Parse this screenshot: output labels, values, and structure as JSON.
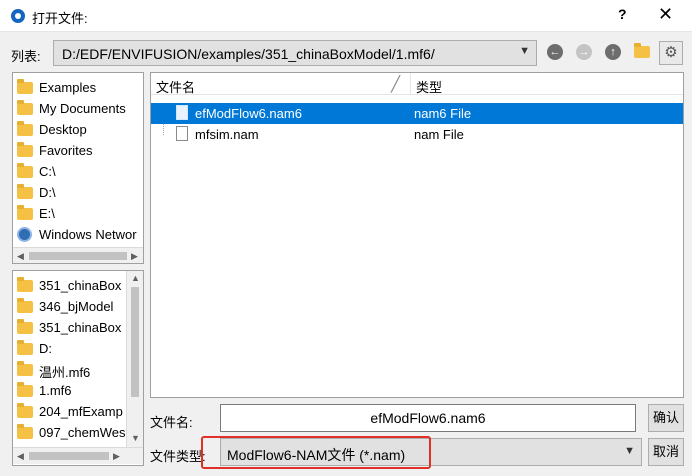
{
  "window": {
    "title": "打开文件:",
    "help": "?",
    "close": "✕"
  },
  "lookin": {
    "label": "列表:",
    "path": "D:/EDF/ENVIFUSION/examples/351_chinaBoxModel/1.mf6/"
  },
  "toolbar": {
    "back": "←",
    "forward": "→",
    "up": "↑",
    "settings": "⚙"
  },
  "sidebar_top": [
    {
      "label": "Examples",
      "icon": "folder-icon"
    },
    {
      "label": "My Documents",
      "icon": "folder-icon"
    },
    {
      "label": "Desktop",
      "icon": "folder-icon"
    },
    {
      "label": "Favorites",
      "icon": "folder-icon"
    },
    {
      "label": "C:\\",
      "icon": "folder-icon"
    },
    {
      "label": "D:\\",
      "icon": "folder-icon"
    },
    {
      "label": "E:\\",
      "icon": "folder-icon"
    },
    {
      "label": "Windows Networ",
      "icon": "network-icon"
    }
  ],
  "sidebar_bottom": [
    {
      "label": "351_chinaBox"
    },
    {
      "label": "346_bjModel"
    },
    {
      "label": "351_chinaBox"
    },
    {
      "label": "D:"
    },
    {
      "label": "温州.mf6"
    },
    {
      "label": "1.mf6"
    },
    {
      "label": "204_mfExamp"
    },
    {
      "label": "097_chemWes"
    }
  ],
  "files": {
    "columns": [
      "文件名",
      "类型"
    ],
    "rows": [
      {
        "name": "efModFlow6.nam6",
        "type": "nam6 File",
        "selected": true
      },
      {
        "name": "mfsim.nam",
        "type": "nam File",
        "selected": false
      }
    ]
  },
  "filename": {
    "label": "文件名:",
    "value": "efModFlow6.nam6"
  },
  "filetype": {
    "label": "文件类型:",
    "value": "ModFlow6-NAM文件 (*.nam)"
  },
  "buttons": {
    "ok": "确认",
    "cancel": "取消"
  },
  "colors": {
    "selection": "#0078d7",
    "highlight_box": "#e0302a",
    "folder": "#f4c144"
  }
}
